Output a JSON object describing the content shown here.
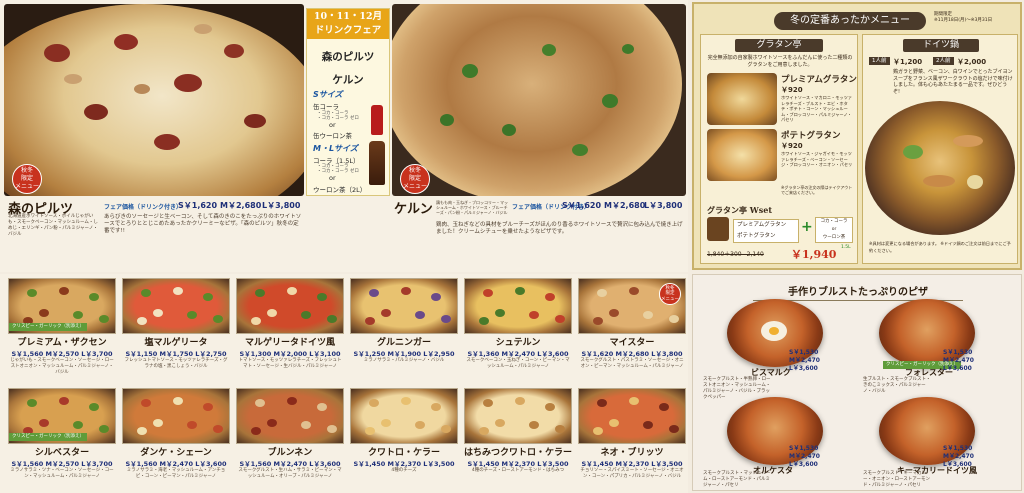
{
  "hero1": {
    "badge": "秋冬\n限定\nメニュー",
    "name": "森のピルツ",
    "price_label": "フェア価格（ドリンク付き）",
    "price_s": "S￥1,620",
    "price_m": "M￥2,680",
    "price_l": "L￥3,800",
    "ingredients": "北海道産ホワイトソース・ボイルじゃがいも・スモークベーコン・マッシュルーム・しめじ・エリンギ・パン粉・パルミジャーノ・バジル",
    "description": "あらびきのソーセージと生ベーコン、そして森のきのこをたっぷりのホワイトソースでとろりととじこめたあったかクリーミーなピザ。「森のピルツ」秋冬の定番です!!"
  },
  "fair": {
    "title1": "10・11・12月",
    "title2": "ドリンクフェア",
    "pizza1": "森のピルツ",
    "pizza2": "ケルン",
    "s_size": "Sサイズ",
    "s_drink1": "缶コーラ",
    "s_drink1_sub": "・コカ・コーラ\n・コカ・コーラ ゼロ",
    "or1": "or",
    "s_drink2": "缶ウーロン茶",
    "ml_size": "M・Lサイズ",
    "ml_drink1": "コーラ（1.5L）",
    "ml_drink1_sub": "・コカ・コーラ\n・コカ・コーラ ゼロ",
    "or2": "or",
    "ml_drink2": "ウーロン茶（2L）"
  },
  "hero2": {
    "badge": "秋冬\n限定\nメニュー",
    "name": "ケルン",
    "ingredients": "鶏もも肉・玉ねぎ・ブロッコリー・マッシュルーム・ホワイトソース・ブルーチーズ・パン粉・パルミジャーノ・バジル",
    "price_label": "フェア価格（ドリンク付き）",
    "price_s": "S￥1,620",
    "price_m": "M￥2,680",
    "price_l": "L￥3,800",
    "description": "鶏肉、玉ねぎなどの具材をブルーチーズがほんのり香るホワイトソースで贅沢に包み込んで焼き上げました！クリームシチューを乗せたようなピザです。"
  },
  "grid": [
    {
      "name": "プレミアム・ザクセン",
      "price": "S￥1,560 M￥2,570 L￥3,700",
      "desc": "じゃがいも・スモークベーコン・ソーセージ・ローストオニオン・マッシュルーム・パルミジャーノ・バジル",
      "tag": "クリスピー・ガーリック（別添え）",
      "badge": ""
    },
    {
      "name": "塩マルゲリータ",
      "price": "S￥1,150 M￥1,750 L￥2,750",
      "desc": "フレッシュトマトソース・モッツァレラチーズ・グラナの塩・黒こしょう・バジル",
      "tag": "",
      "badge": ""
    },
    {
      "name": "マルゲリータドイツ風",
      "price": "S￥1,300 M￥2,000 L￥3,100",
      "desc": "トマトソース・モッツァレラチーズ・フレッシュトマト・ソーセージ・生バジル・パルミジャーノ",
      "tag": "",
      "badge": ""
    },
    {
      "name": "グルニンガー",
      "price": "S￥1,250 M￥1,900 L￥2,950",
      "desc": "ミラノサラミ・パルミジャーノ・バジル",
      "tag": "",
      "badge": ""
    },
    {
      "name": "シュテルン",
      "price": "S￥1,360 M￥2,470 L￥3,600",
      "desc": "スモークベーコン・玉ねぎ・コーン・ピーマン・マッシュルーム・パルミジャーノ",
      "tag": "",
      "badge": ""
    },
    {
      "name": "マイスター",
      "price": "S￥1,620 M￥2,680 L￥3,800",
      "desc": "スモークグルスト・パストラミ・ソーセージ・オニオン・ピーマン・マッシュルーム・パルミジャーノ",
      "tag": "",
      "badge": "秋冬\n限定\nメニュー"
    },
    {
      "name": "シルベスター",
      "price": "S￥1,560 M￥2,570 L￥3,700",
      "desc": "ミラノサラミ・ツナ・ベーコン・ソーセージ・コーン・マッシュルーム・パルミジャーノ",
      "tag": "クリスピー・ガーリック（別添え）",
      "badge": ""
    },
    {
      "name": "ダンケ・シェーン",
      "price": "S￥1,560 M￥2,470 L￥3,600",
      "desc": "ミラノサラミ・海老・マッシュルーム・アンチョビ・コーン・ピーマン・パルミジャーノ",
      "tag": "",
      "badge": ""
    },
    {
      "name": "ブルンネン",
      "price": "S￥1,560 M￥2,470 L￥3,600",
      "desc": "スモークグルスト・生ハム・サラミ・ピーマン・マッシュルーム・オリーブ・パルミジャーノ",
      "tag": "",
      "badge": ""
    },
    {
      "name": "クワトロ・ケラー",
      "price": "S￥1,450 M￥2,370 L￥3,500",
      "desc": "4種のチーズ",
      "tag": "",
      "badge": ""
    },
    {
      "name": "はちみつクワトロ・ケラー",
      "price": "S￥1,450 M￥2,370 L￥3,500",
      "desc": "4種のチーズ・ローストアーモンド・はちみつ",
      "tag": "",
      "badge": ""
    },
    {
      "name": "ネオ・ブリッツ",
      "price": "S￥1,450 M￥2,370 L￥3,500",
      "desc": "チョリソー・スパイスミート・ソーセージ・オニオン・コーン・パプリカ・パルミジャーノ・バジル",
      "tag": "",
      "badge": ""
    }
  ],
  "winter": {
    "head": "冬の定番あったかメニュー",
    "limit": "期間限定\n※11月18日(月)〜※3月31日",
    "gratin_title": "グラタン亭",
    "gratin_intro": "完全無添加の自家製ホワイトソースをふんだんに使った二種類のグラタンをご用意しました。",
    "g1_name": "プレミアムグラタン",
    "g1_price": "￥920",
    "g1_desc": "ホワイトソース・マカロニ・モッツァレラチーズ・ブルスト・エビ・ホタテ・ポテト・コーン・マッシュルーム・ブロッコリー・パルミジャーノ・パセリ",
    "g2_name": "ポテトグラタン",
    "g2_price": "￥920",
    "g2_desc": "ホワイトソース・ジャガイモ・モッツァレラチーズ・ベーコン・ソーセージ・ブロッコリー・オニオン・パセリ",
    "g_note": "※グラタン亭の注文の際はテイクアウトでご来店ください。",
    "wset_title": "グラタン亭 Wset",
    "wset_item1": "プレミアムグラタン",
    "wset_item2": "ポテトグラタン",
    "wset_plus": "+",
    "wset_cola": "コカ・コーラ\nor\nウーロン茶",
    "wset_size": "1.5L",
    "wset_price_calc": "1,840＋300−2,140",
    "wset_price": "￥1,940",
    "doitsu_title": "ドイツ鍋",
    "d_size1": "1人前",
    "d_price1": "￥1,200",
    "d_size2": "2人前",
    "d_price2": "￥2,000",
    "d_desc": "鶏ガラと野菜、ベーコン、白ワインでとったブイヨンスープをフランス風ザワークラウトの塩だけで味付けしました。体も心もあたたまる一品です。ぜひどうぞ!",
    "d_note": "※具材は変更になる場合があります。 ※ドイツ鍋のご注文は前日までにご予約ください。"
  },
  "bulst": {
    "head": "手作りブルストたっぷりのピザ",
    "items": [
      {
        "name": "ビスマルク",
        "price": "S￥1,530\nM￥2,470\nL￥3,600",
        "desc": "スモークブルスト・半熟卵・ローストオニオン・マッシュルーム・パルミジャーノ・バジル・ブラックペッパー",
        "tag": ""
      },
      {
        "name": "フォレスター",
        "price": "S￥1,530\nM￥2,470\nL￥3,600",
        "desc": "生ブルスト・スモークブルスト・きのこミックス・パルミジャーノ・バジル",
        "tag": "クリスピー・ガーリック（別添え）"
      },
      {
        "name": "オルケスタ",
        "price": "S￥1,530\nM￥2,470\nL￥3,600",
        "desc": "スモークブルスト・マッシュルーム・ローストアーモンド・パルミジャーノ・パセリ",
        "tag": ""
      },
      {
        "name": "キーマカリードイツ風",
        "price": "S￥1,530\nM￥2,470\nL￥3,600",
        "desc": "スモークブルスト・キーマカレー・オニオン・ローストアーモンド・パルミジャーノ・パセリ",
        "tag": ""
      }
    ]
  }
}
